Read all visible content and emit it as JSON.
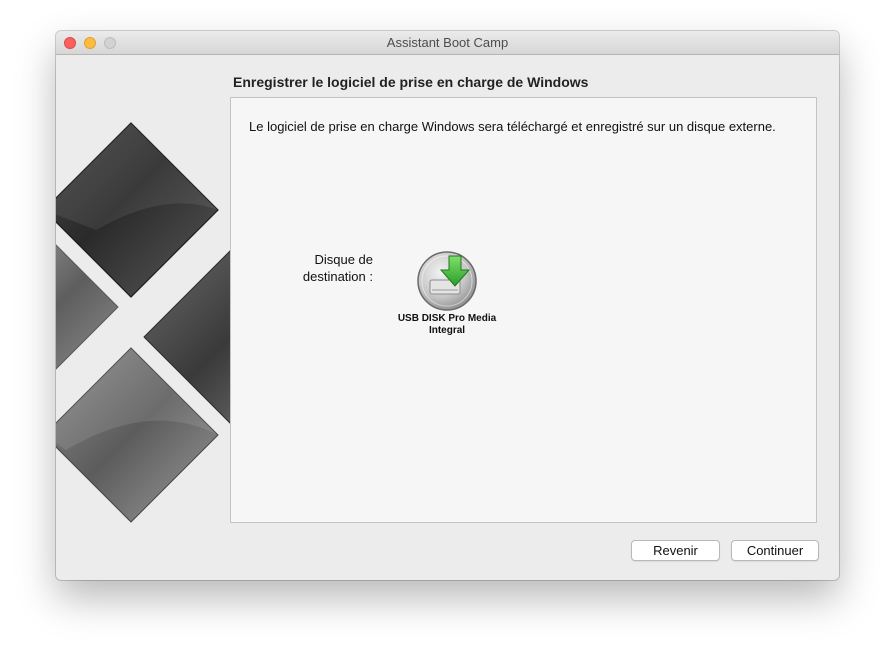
{
  "window": {
    "title": "Assistant Boot Camp"
  },
  "page": {
    "title": "Enregistrer le logiciel de prise en charge de Windows",
    "description": "Le logiciel de prise en charge Windows sera téléchargé et enregistré sur un disque externe."
  },
  "destination": {
    "label": "Disque de destination :",
    "disk_name": "USB DISK Pro Media Integral",
    "disk_icon": "usb-disk-download-icon"
  },
  "buttons": {
    "back_label": "Revenir",
    "continue_label": "Continuer"
  },
  "colors": {
    "close": "#fc605c",
    "minimize": "#fdbc40",
    "zoom": "#d2d2d2",
    "download_arrow": "#3fc23a"
  }
}
